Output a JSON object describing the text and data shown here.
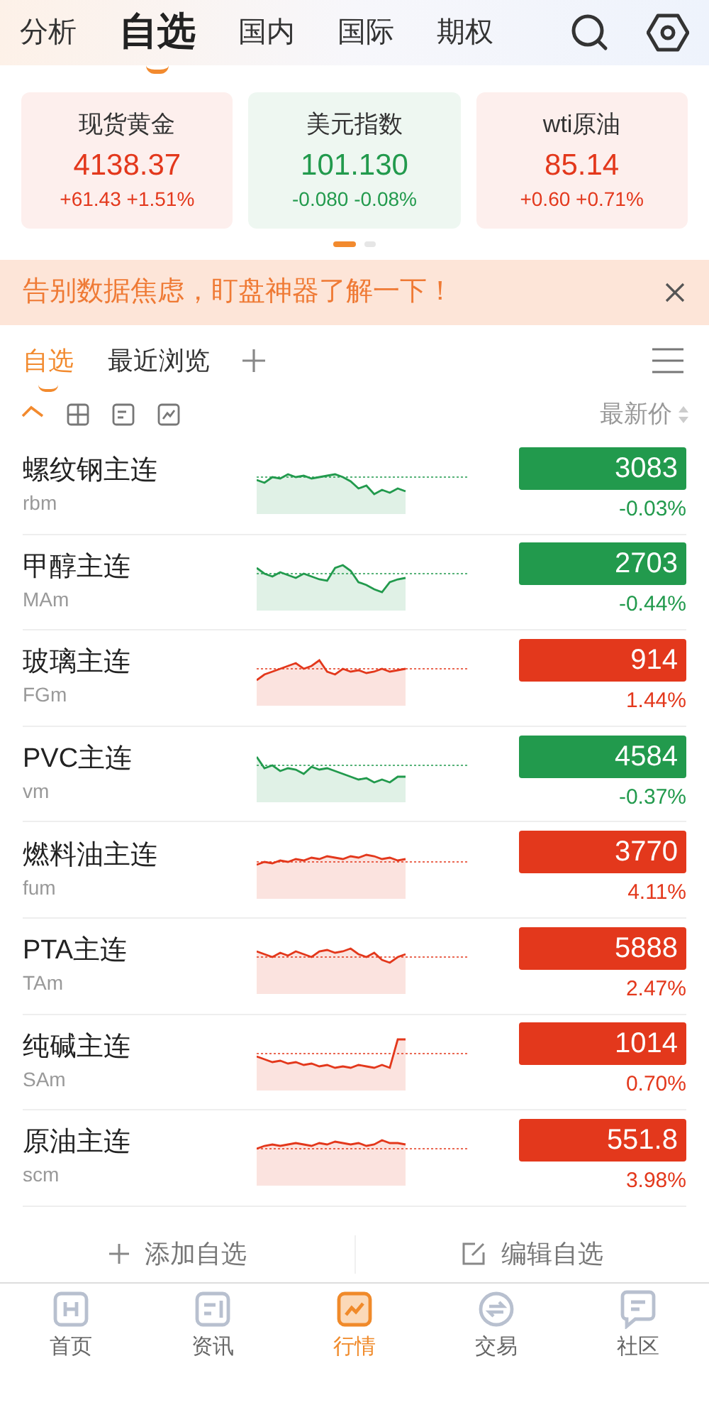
{
  "top_tabs": [
    {
      "label": "分析",
      "selected": false
    },
    {
      "label": "自选",
      "selected": true
    },
    {
      "label": "国内",
      "selected": false
    },
    {
      "label": "国际",
      "selected": false
    },
    {
      "label": "期权",
      "selected": false
    }
  ],
  "index_cards": [
    {
      "name": "现货黄金",
      "price": "4138.37",
      "change": "+61.43 +1.51%",
      "color": "#e3381c"
    },
    {
      "name": "美元指数",
      "price": "101.130",
      "change": "-0.080 -0.08%",
      "color": "#229a4d"
    },
    {
      "name": "wti原油",
      "price": "85.14",
      "change": "+0.60 +0.71%",
      "color": "#e3381c"
    }
  ],
  "pager": [
    {
      "selected": true
    },
    {
      "selected": false
    }
  ],
  "banner": {
    "text": "告别数据焦虑，盯盘神器了解一下！"
  },
  "list_tabs": [
    {
      "label": "自选",
      "selected": true
    },
    {
      "label": "最近浏览",
      "selected": false
    }
  ],
  "view_modes": [
    {
      "kind": "trend",
      "selected": true
    },
    {
      "kind": "grid",
      "selected": false
    },
    {
      "kind": "card",
      "selected": false
    },
    {
      "kind": "chart",
      "selected": false
    }
  ],
  "sort_label": "最新价",
  "rows": [
    {
      "name": "螺纹钢主连",
      "code": "rbm",
      "price": "3083",
      "change": "-0.03%",
      "color": "#229a4d"
    },
    {
      "name": "甲醇主连",
      "code": "MAm",
      "price": "2703",
      "change": "-0.44%",
      "color": "#229a4d"
    },
    {
      "name": "玻璃主连",
      "code": "FGm",
      "price": "914",
      "change": "1.44%",
      "color": "#e3381c"
    },
    {
      "name": "PVC主连",
      "code": "vm",
      "price": "4584",
      "change": "-0.37%",
      "color": "#229a4d"
    },
    {
      "name": "燃料油主连",
      "code": "fum",
      "price": "3770",
      "change": "4.11%",
      "color": "#e3381c"
    },
    {
      "name": "PTA主连",
      "code": "TAm",
      "price": "5888",
      "change": "2.47%",
      "color": "#e3381c"
    },
    {
      "name": "纯碱主连",
      "code": "SAm",
      "price": "1014",
      "change": "0.70%",
      "color": "#e3381c"
    },
    {
      "name": "原油主连",
      "code": "scm",
      "price": "551.8",
      "change": "3.98%",
      "color": "#e3381c"
    }
  ],
  "actions": [
    {
      "kind": "add",
      "label": "添加自选"
    },
    {
      "kind": "edit",
      "label": "编辑自选"
    }
  ],
  "bottom_nav": [
    {
      "kind": "home",
      "label": "首页",
      "selected": false
    },
    {
      "kind": "news",
      "label": "资讯",
      "selected": false
    },
    {
      "kind": "market",
      "label": "行情",
      "selected": true
    },
    {
      "kind": "trade",
      "label": "交易",
      "selected": false
    },
    {
      "kind": "community",
      "label": "社区",
      "selected": false
    }
  ]
}
